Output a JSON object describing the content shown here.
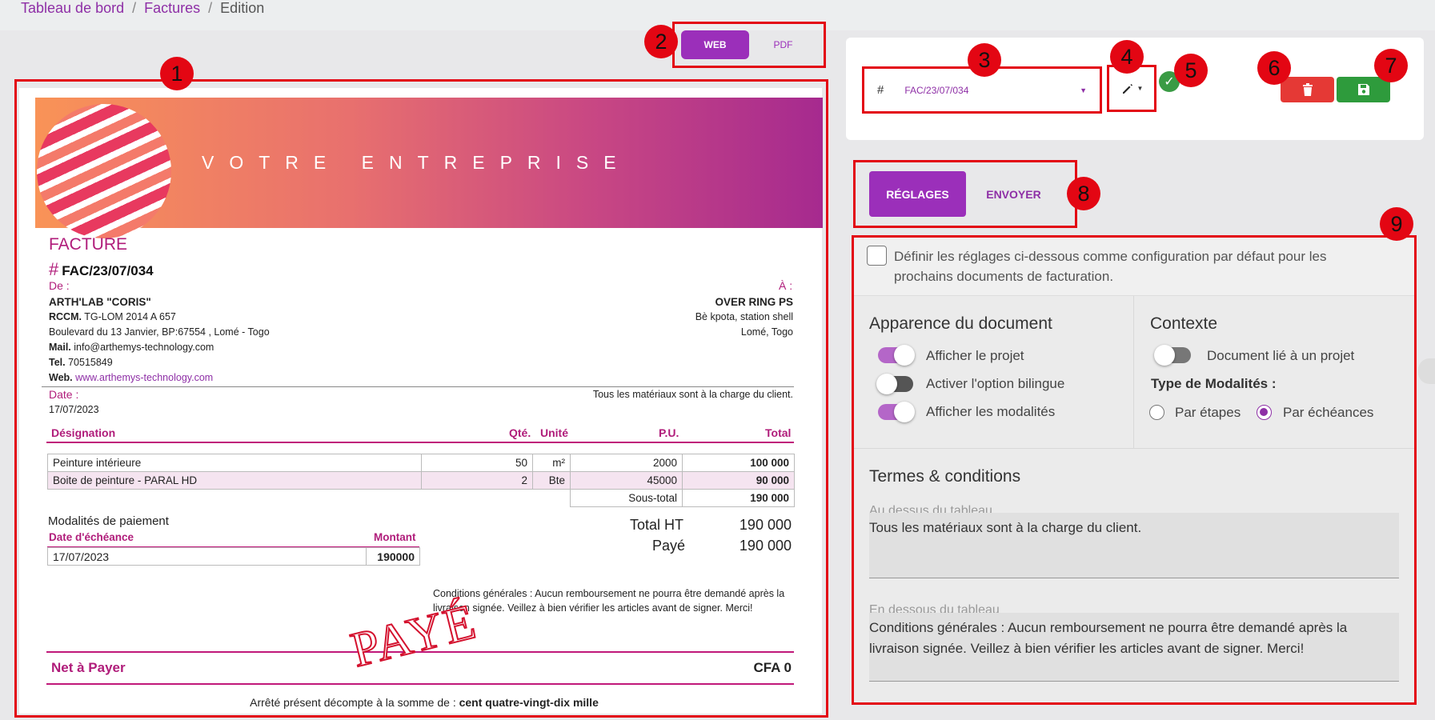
{
  "breadcrumb": {
    "items": [
      "Tableau de bord",
      "Factures",
      "Edition"
    ]
  },
  "view_toggle": {
    "web": "WEB",
    "pdf": "PDF"
  },
  "callouts": [
    "1",
    "2",
    "3",
    "4",
    "5",
    "6",
    "7",
    "8",
    "9"
  ],
  "invoice": {
    "company_banner": "VOTRE ENTREPRISE",
    "doc_type": "FACTURE",
    "hash": "#",
    "number": "FAC/23/07/034",
    "from_label": "De :",
    "to_label": "À :",
    "seller": {
      "name": "ARTH'LAB \"CORIS\"",
      "rccm_label": "RCCM.",
      "rccm": "TG-LOM 2014 A 657",
      "address": "Boulevard du 13 Janvier, BP:67554 , Lomé - Togo",
      "mail_label": "Mail.",
      "mail": "info@arthemys-technology.com",
      "tel_label": "Tel.",
      "tel": "70515849",
      "web_label": "Web.",
      "web": "www.arthemys-technology.com"
    },
    "buyer": {
      "name": "OVER RING PS",
      "line1": "Bè kpota, station shell",
      "line2": "Lomé, Togo"
    },
    "date_label": "Date :",
    "date": "17/07/2023",
    "note_above": "Tous les matériaux sont à la charge du client.",
    "columns": {
      "designation": "Désignation",
      "qty": "Qté.",
      "unit": "Unité",
      "pu": "P.U.",
      "total": "Total"
    },
    "rows": [
      {
        "designation": "Peinture intérieure",
        "qty": "50",
        "unit": "m²",
        "pu": "2000",
        "total": "100 000"
      },
      {
        "designation": "Boite de peinture - PARAL HD",
        "qty": "2",
        "unit": "Bte",
        "pu": "45000",
        "total": "90 000"
      }
    ],
    "subtotal_label": "Sous-total",
    "subtotal": "190 000",
    "payment_title": "Modalités de paiement",
    "payment_cols": {
      "due": "Date d'échéance",
      "amount": "Montant"
    },
    "payment_row": {
      "due": "17/07/2023",
      "amount": "190000"
    },
    "total_ht_label": "Total HT",
    "total_ht": "190 000",
    "paid_label": "Payé",
    "paid": "190 000",
    "conditions": "Conditions générales : Aucun remboursement ne pourra être demandé après la livraison signée. Veillez à bien vérifier les articles avant de signer. Merci!",
    "stamp": "PAYÉ",
    "net_label": "Net à Payer",
    "net_value": "CFA 0",
    "in_words_prefix": "Arrêté présent décompte à la somme de :",
    "in_words": "cent quatre-vingt-dix mille"
  },
  "toolbar": {
    "hash": "#",
    "selected_invoice": "FAC/23/07/034"
  },
  "tabs": {
    "settings": "RÉGLAGES",
    "send": "ENVOYER"
  },
  "settings": {
    "default_checkbox": "Définir les réglages ci-dessous comme configuration par défaut pour les prochains documents de facturation.",
    "default_checked": false,
    "appearance_title": "Apparence du document",
    "show_project": "Afficher le projet",
    "show_project_on": true,
    "bilingual": "Activer l'option bilingue",
    "bilingual_on": false,
    "show_terms": "Afficher les modalités",
    "show_terms_on": true,
    "context_title": "Contexte",
    "linked_project": "Document lié à un projet",
    "linked_project_on": false,
    "modalities_type_label": "Type de Modalités :",
    "radio_steps": "Par étapes",
    "radio_due": "Par échéances",
    "selected_radio": "Par échéances",
    "terms_title": "Termes & conditions",
    "above_label": "Au dessus du tableau",
    "above_text": "Tous les matériaux sont à la charge du client.",
    "below_label": "En dessous du tableau",
    "below_text": "Conditions générales : Aucun remboursement ne pourra être demandé après la livraison signée. Veillez à bien vérifier les articles avant de signer. Merci!"
  },
  "colors": {
    "accent": "#9b2fba",
    "invoice_accent": "#b01c7a",
    "annotation": "#e30613",
    "delete": "#e53935",
    "save": "#2e9b3c"
  }
}
